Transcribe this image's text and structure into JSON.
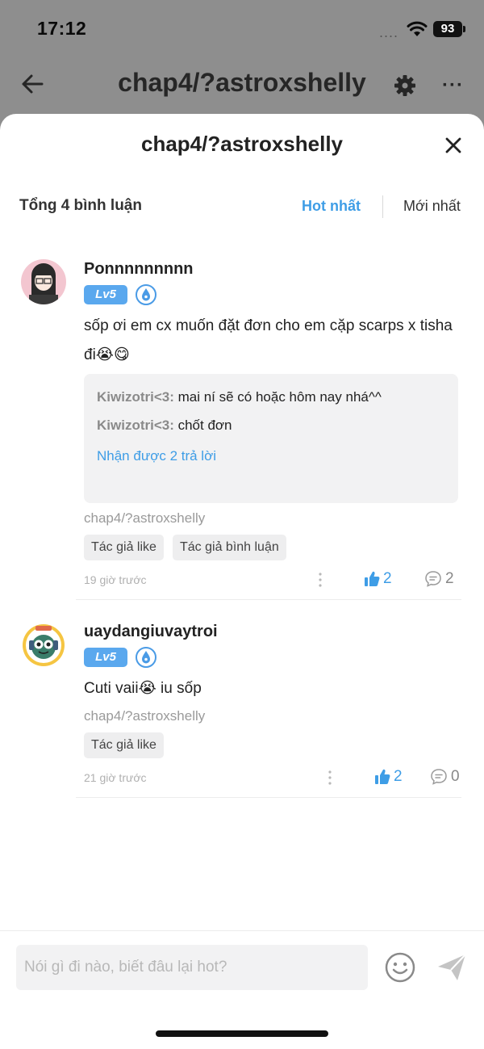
{
  "status_bar": {
    "time": "17:12",
    "signal_dots": "....",
    "battery": "93"
  },
  "background_nav": {
    "title": "chap4/?astroxshelly",
    "more_label": "···"
  },
  "sheet": {
    "title": "chap4/?astroxshelly",
    "count_label": "Tổng 4 bình luận",
    "sort_options": {
      "hot": "Hot nhất",
      "new": "Mới nhất"
    }
  },
  "comments": [
    {
      "username": "Ponnnnnnnnn",
      "level": "Lv5",
      "text": "sốp ơi em cx muốn đặt đơn cho em cặp scarps x tisha đi😭😋",
      "replies": [
        {
          "user": "Kiwizotri<3:",
          "text": " mai ní sẽ có hoặc hôm nay nhá^^"
        },
        {
          "user": "Kiwizotri<3:",
          "text": " chốt đơn"
        }
      ],
      "more_replies": "Nhận được 2 trả lời",
      "chapter": "chap4/?astroxshelly",
      "tags": [
        "Tác giả like",
        "Tác giả bình luận"
      ],
      "time": "19 giờ trước",
      "likes": "2",
      "reply_count": "2"
    },
    {
      "username": "uaydangiuvaytroi",
      "level": "Lv5",
      "text": "Cuti vaii😭 iu sốp",
      "chapter": "chap4/?astroxshelly",
      "tags": [
        "Tác giả like"
      ],
      "time": "21 giờ trước",
      "likes": "2",
      "reply_count": "0"
    }
  ],
  "input": {
    "placeholder": "Nói gì đi nào, biết đâu lại hot?"
  },
  "colors": {
    "accent": "#3e9de6",
    "level_badge": "#5aa8ee",
    "overlay": "#8e8e8e"
  },
  "icons": [
    "back-icon",
    "gear-icon",
    "more-icon",
    "close-icon",
    "drop-badge-icon",
    "kebab-icon",
    "thumbs-up-icon",
    "comment-bubble-icon",
    "emoji-icon",
    "send-icon",
    "wifi-icon"
  ]
}
